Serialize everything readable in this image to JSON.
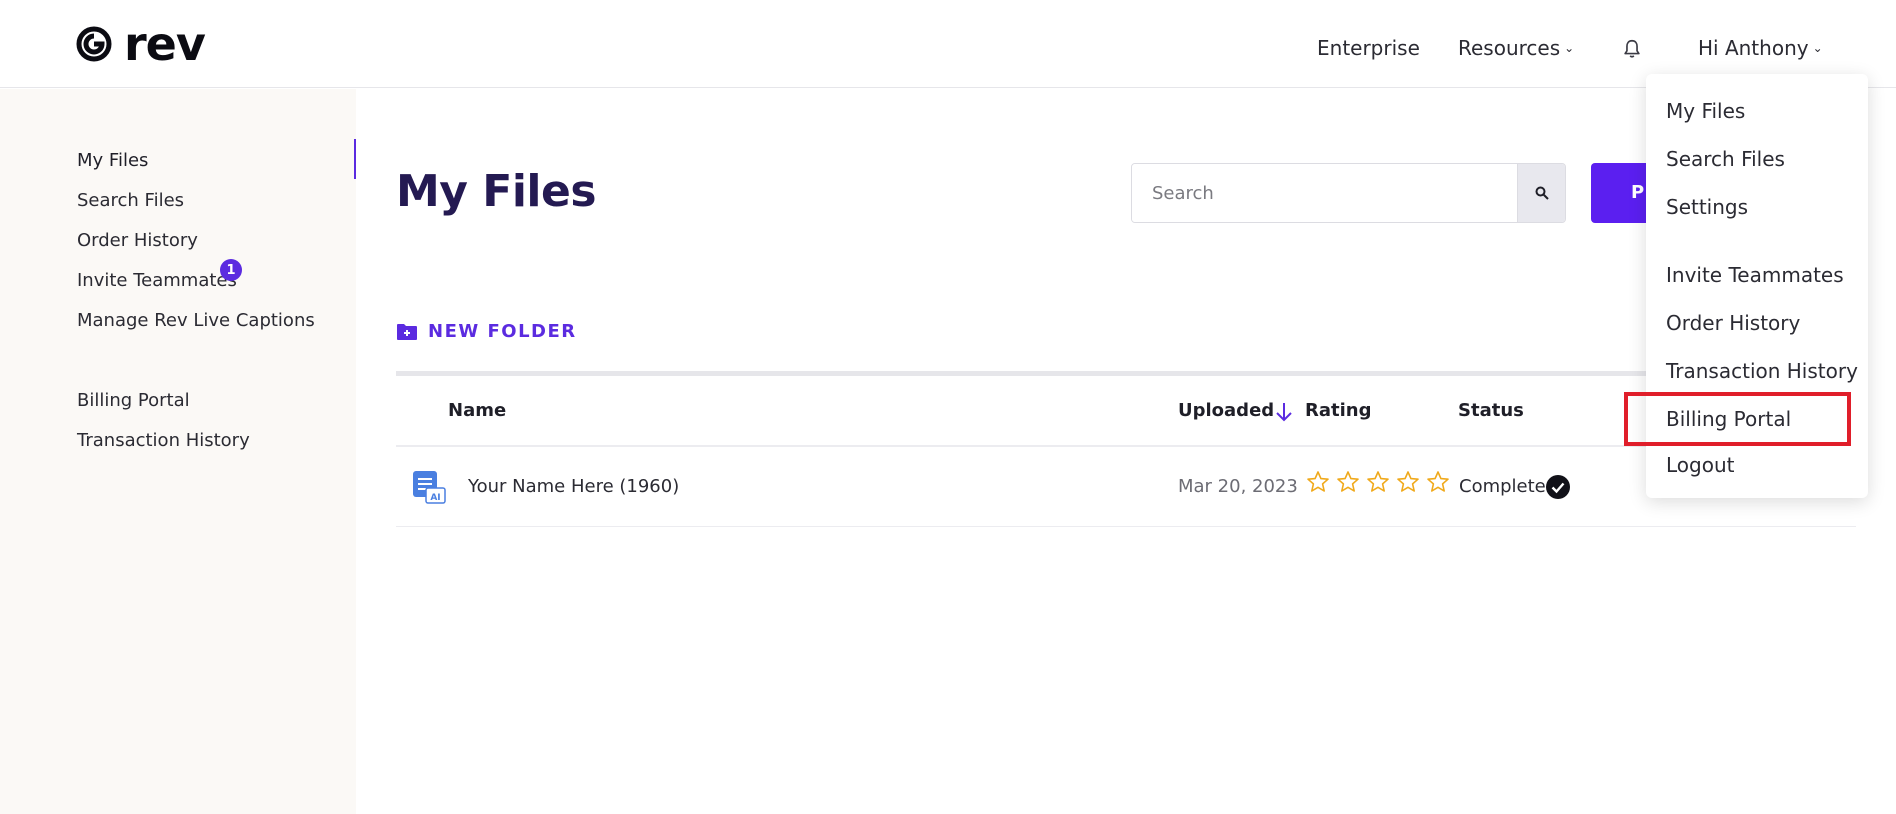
{
  "header": {
    "logo_text": "rev",
    "nav": {
      "enterprise": "Enterprise",
      "resources": "Resources",
      "user": "Hi Anthony"
    }
  },
  "sidebar": {
    "items": [
      {
        "label": "My Files"
      },
      {
        "label": "Search Files"
      },
      {
        "label": "Order History"
      },
      {
        "label": "Invite Teammates"
      },
      {
        "label": "Manage Rev Live Captions"
      },
      {
        "label": "Billing Portal"
      },
      {
        "label": "Transaction History"
      }
    ],
    "invite_badge": "1"
  },
  "main": {
    "title": "My Files",
    "search_placeholder": "Search",
    "primary_button_label": "P",
    "new_folder_label": "NEW FOLDER",
    "table": {
      "columns": [
        "Name",
        "Uploaded",
        "Rating",
        "Status"
      ],
      "rows": [
        {
          "name": "Your Name Here (1960)",
          "uploaded": "Mar 20, 2023",
          "rating": 0,
          "rating_max": 5,
          "status": "Complete"
        }
      ]
    }
  },
  "user_menu": {
    "items": [
      {
        "label": "My Files"
      },
      {
        "label": "Search Files"
      },
      {
        "label": "Settings"
      },
      {
        "label": "Invite Teammates"
      },
      {
        "label": "Order History"
      },
      {
        "label": "Transaction History"
      },
      {
        "label": "Billing Portal"
      },
      {
        "label": "Logout"
      }
    ]
  },
  "colors": {
    "accent": "#5b2be0",
    "title": "#241a52",
    "star": "#f0a91b",
    "highlight": "#e01e2a",
    "sidebar_bg": "#fbf9f6"
  }
}
